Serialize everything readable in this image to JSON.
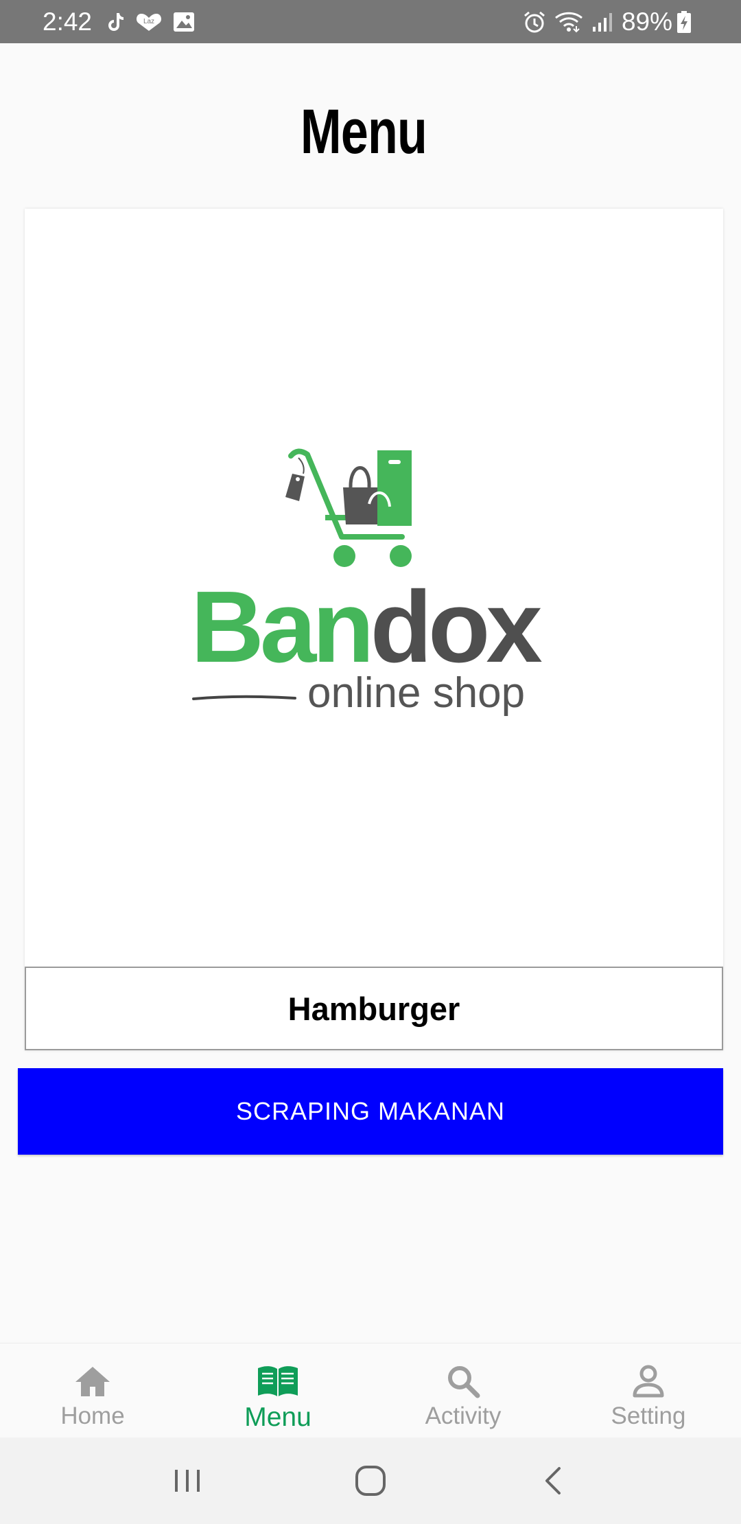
{
  "status_bar": {
    "time": "2:42",
    "battery": "89%",
    "left_icons": [
      "tiktok-icon",
      "lazada-icon",
      "gallery-icon"
    ],
    "right_icons": [
      "alarm-icon",
      "wifi-icon",
      "signal-icon",
      "battery-charging-icon"
    ]
  },
  "page": {
    "title": "Menu"
  },
  "card": {
    "logo": {
      "brand_part1": "Ban",
      "brand_part2": "dox",
      "tagline": "online shop"
    },
    "item_name": "Hamburger"
  },
  "actions": {
    "scrape_label": "SCRAPING MAKANAN",
    "scrape_color": "#0000fe"
  },
  "bottom_nav": {
    "active_color": "#0f9d58",
    "inactive_color": "#9e9e9e",
    "items": [
      {
        "label": "Home",
        "icon": "home-icon"
      },
      {
        "label": "Menu",
        "icon": "book-icon"
      },
      {
        "label": "Activity",
        "icon": "search-icon"
      },
      {
        "label": "Setting",
        "icon": "person-icon"
      }
    ]
  },
  "system_nav": [
    "recents-icon",
    "home-circle-icon",
    "back-icon"
  ]
}
